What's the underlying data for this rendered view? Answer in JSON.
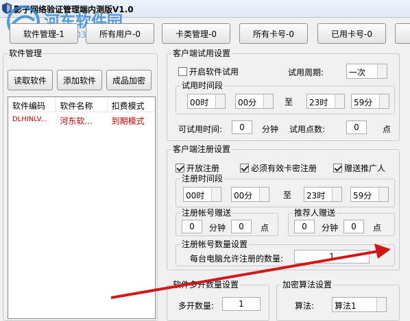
{
  "window": {
    "title": "影子网络验证管理端内测版V1.0"
  },
  "watermark": {
    "text": "河东软件园",
    "url": "www.pc0359.cn"
  },
  "tabs": [
    {
      "label": "软件管理-1"
    },
    {
      "label": "所有用户-0"
    },
    {
      "label": "卡类管理-0"
    },
    {
      "label": "所有卡号-0"
    },
    {
      "label": "已用卡号-0"
    }
  ],
  "software": {
    "group_title": "软件管理",
    "read_button": "读取软件",
    "add_button": "添加软件",
    "encrypt_button": "成品加密",
    "columns": [
      "软件编码",
      "软件名称",
      "扣费模式"
    ],
    "rows": [
      [
        "DLHINLV...",
        "河东软...",
        "到期模式"
      ]
    ]
  },
  "trial": {
    "group_title": "客户端试用设置",
    "enable_label": "开启软件试用",
    "enable_checked": false,
    "period_label": "试用周期:",
    "period_value": "一次",
    "time_group_title": "试用时间段",
    "start_hour": "00时",
    "start_min": "00分",
    "to": "至",
    "end_hour": "23时",
    "end_min": "59分",
    "time_label": "可试用时间:",
    "time_value": "0",
    "time_unit": "分钟",
    "points_label": "试用点数:",
    "points_value": "0",
    "points_unit": "点"
  },
  "register": {
    "group_title": "客户端注册设置",
    "open_label": "开放注册",
    "open_checked": true,
    "need_card_label": "必须有效卡密注册",
    "need_card_checked": true,
    "gift_label": "赠送推广人",
    "gift_checked": true,
    "time_group_title": "注册时间段",
    "start_hour": "00时",
    "start_min": "00分",
    "to": "至",
    "end_hour": "23时",
    "end_min": "59分",
    "account_gift_title": "注册帐号赠送",
    "account_gift_min": "0",
    "account_gift_min_unit": "分钟",
    "account_gift_points": "0",
    "account_gift_points_unit": "点",
    "referrer_gift_title": "推荐人赠送",
    "referrer_gift_min": "0",
    "referrer_gift_min_unit": "分钟",
    "referrer_gift_points": "0",
    "referrer_gift_points_unit": "点",
    "count_title": "注册帐号数量设置",
    "count_label": "每台电脑允许注册的数量:",
    "count_value": "1"
  },
  "multi": {
    "group_title": "软件多开数量设置",
    "label": "多开数量:",
    "value": "1"
  },
  "algo": {
    "group_title": "加密算法设置",
    "label": "算法:",
    "value": "算法1"
  },
  "colors": {
    "list_row_text": "#c00000",
    "arrow": "#d01818",
    "watermark": "#2f86d2"
  }
}
